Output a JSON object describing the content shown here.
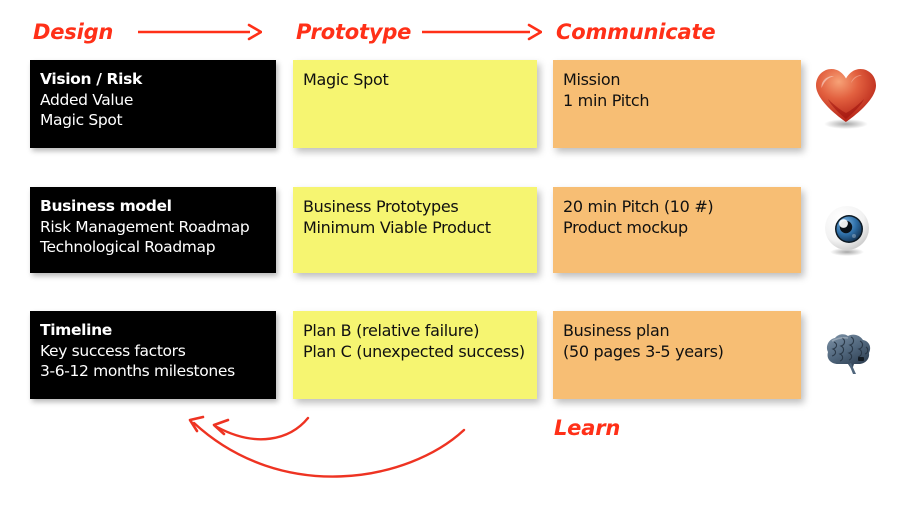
{
  "diagram": {
    "title_row": {
      "columns": [
        {
          "id": "design",
          "label": "Design"
        },
        {
          "id": "prototype",
          "label": "Prototype"
        },
        {
          "id": "communicate",
          "label": "Communicate"
        }
      ],
      "arrows": [
        {
          "id": "design-to-prototype",
          "name": "right-arrow-icon"
        },
        {
          "id": "prototype-to-communicate",
          "name": "right-arrow-icon"
        }
      ]
    },
    "rows": [
      {
        "id": "row-1",
        "design": {
          "lines": [
            "Vision / Risk",
            "Added Value",
            "Magic Spot"
          ]
        },
        "prototype": {
          "lines": [
            "Magic Spot"
          ]
        },
        "communicate": {
          "lines": [
            "Mission",
            "1 min Pitch"
          ]
        },
        "icon": {
          "name": "heart-icon",
          "label": "Heart"
        }
      },
      {
        "id": "row-2",
        "design": {
          "lines": [
            "Business model",
            "Risk Management Roadmap",
            "Technological Roadmap"
          ]
        },
        "prototype": {
          "lines": [
            "Business Prototypes",
            "Minimum Viable Product"
          ]
        },
        "communicate": {
          "lines": [
            "20 min Pitch (10 #)",
            "Product mockup"
          ]
        },
        "icon": {
          "name": "eye-icon",
          "label": "Eye"
        }
      },
      {
        "id": "row-3",
        "design": {
          "lines": [
            "Timeline",
            "Key success factors",
            "3-6-12 months milestones"
          ]
        },
        "prototype": {
          "lines": [
            "Plan B (relative failure)",
            "Plan C (unexpected success)"
          ]
        },
        "communicate": {
          "lines": [
            "Business plan",
            "(50 pages 3-5 years)"
          ]
        },
        "icon": {
          "name": "brain-icon",
          "label": "Brain"
        }
      }
    ],
    "feedback": {
      "label": "Learn",
      "arrows": [
        {
          "id": "learn-short-loop",
          "name": "curved-left-arrow-icon"
        },
        {
          "id": "learn-long-loop",
          "name": "curved-left-arrow-icon"
        }
      ]
    },
    "colors": {
      "accent_red": "#FF3018",
      "design_box": "#000000",
      "prototype_box": "#F6F571",
      "communicate_box": "#F7BE74",
      "page_background": "#FFFFFF"
    }
  }
}
